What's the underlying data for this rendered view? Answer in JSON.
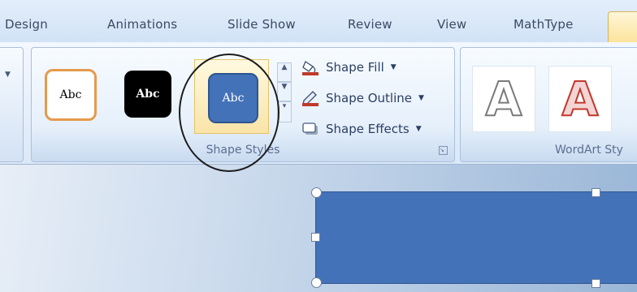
{
  "tabs": [
    "Design",
    "Animations",
    "Slide Show",
    "Review",
    "View",
    "MathType"
  ],
  "shape_styles": {
    "thumbnails": [
      {
        "label": "Abc",
        "fill": "#ffffff",
        "border": "#e59a4c",
        "text_color": "#333333"
      },
      {
        "label": "Abc",
        "fill": "#000000",
        "border": "#000000",
        "text_color": "#ffffff"
      },
      {
        "label": "Abc",
        "fill": "#4472b8",
        "border": "#2e5690",
        "text_color": "#ffffff",
        "selected": true
      }
    ],
    "commands": {
      "fill_label": "Shape Fill",
      "outline_label": "Shape Outline",
      "effects_label": "Shape Effects"
    },
    "group_label": "Shape Styles"
  },
  "wordart": {
    "letters": [
      "A",
      "A"
    ],
    "group_label": "WordArt Sty"
  },
  "colors": {
    "accent": "#4472b8",
    "highlight_circle": "#1c1c1c",
    "wordart_red": "#c0392b"
  },
  "icons": {
    "fill": "paint-bucket-icon",
    "outline": "pencil-icon",
    "effects": "shape-effects-icon"
  }
}
